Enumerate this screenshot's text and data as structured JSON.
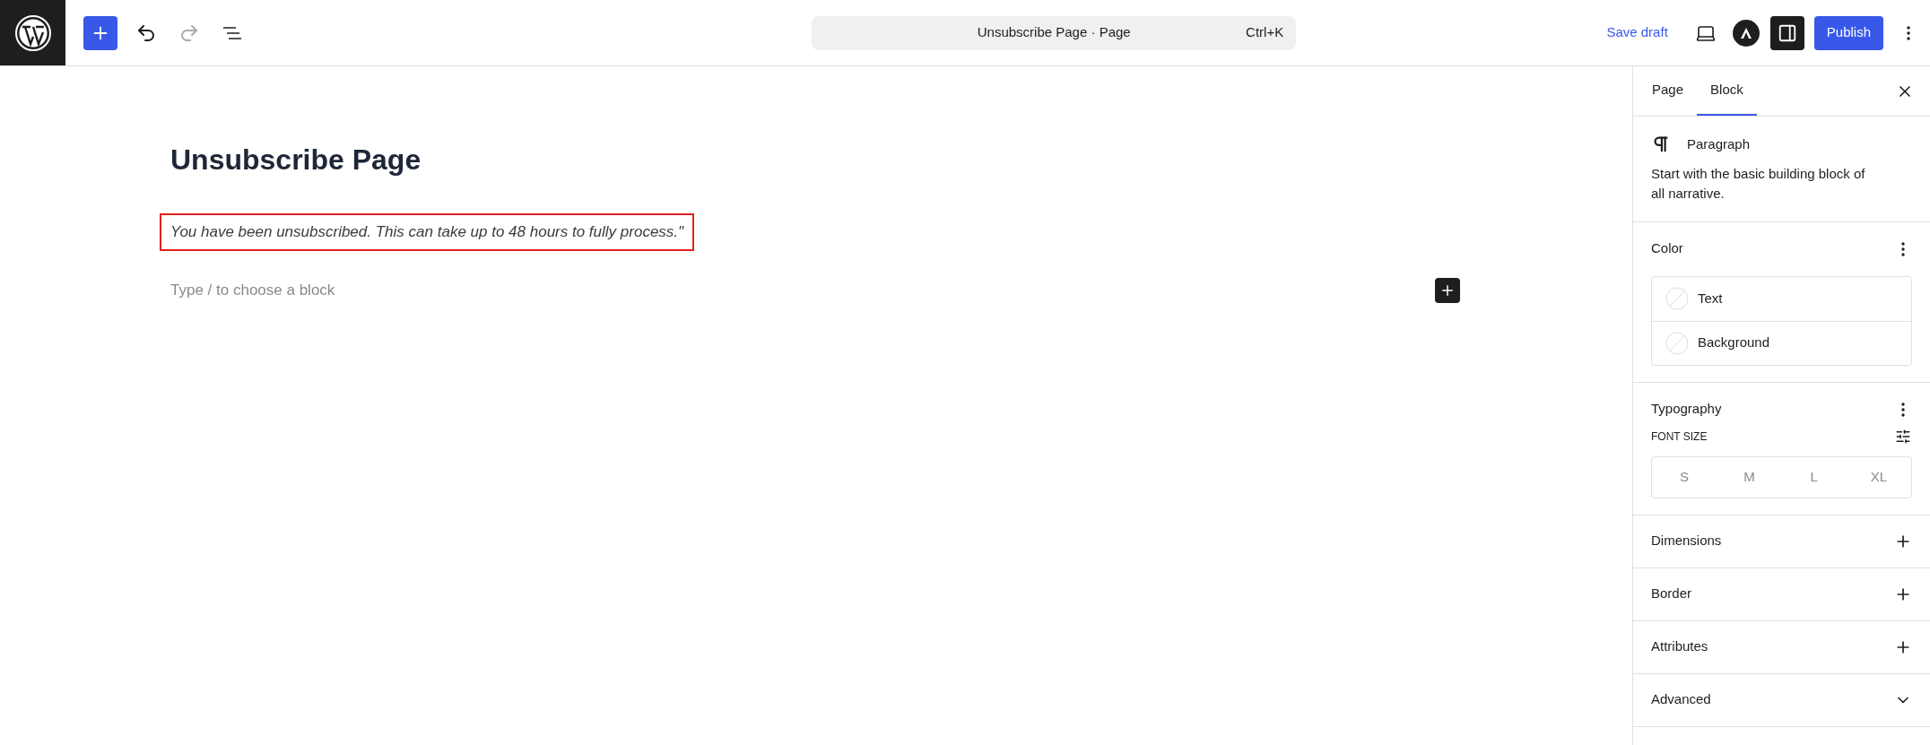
{
  "toolbar": {
    "undo": {
      "disabled": false
    },
    "redo": {
      "disabled": true
    },
    "command_bar": {
      "title": "Unsubscribe Page · Page",
      "shortcut": "Ctrl+K"
    },
    "save_draft": "Save draft",
    "settings_toggle": {
      "pressed": true
    },
    "publish": "Publish"
  },
  "editor": {
    "title": "Unsubscribe Page",
    "blocks": [
      {
        "kind": "paragraph",
        "text": "You have been unsubscribed. This can take up to 48 hours to fully process.\"",
        "selected": true
      },
      {
        "kind": "placeholder",
        "placeholder": "Type / to choose a block"
      }
    ]
  },
  "sidebar": {
    "tabs": [
      {
        "label": "Page",
        "selected": false
      },
      {
        "label": "Block",
        "selected": true
      }
    ],
    "block_card": {
      "name": "Paragraph",
      "description": "Start with the basic building block of all narrative."
    },
    "color": {
      "title": "Color",
      "items": [
        {
          "label": "Text"
        },
        {
          "label": "Background"
        }
      ]
    },
    "typography": {
      "title": "Typography",
      "font_size_label": "FONT SIZE",
      "sizes": [
        {
          "label": "S",
          "selected": false
        },
        {
          "label": "M",
          "selected": false
        },
        {
          "label": "L",
          "selected": false
        },
        {
          "label": "XL",
          "selected": false
        }
      ]
    },
    "panels": [
      {
        "title": "Dimensions",
        "kind": "tools"
      },
      {
        "title": "Border",
        "kind": "tools"
      },
      {
        "title": "Attributes",
        "kind": "tools"
      },
      {
        "title": "Advanced",
        "kind": "collapsible"
      }
    ]
  }
}
